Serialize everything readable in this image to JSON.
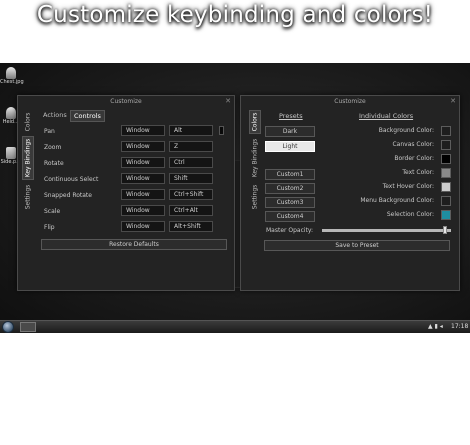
{
  "banner": {
    "title": "Customize keybinding and colors!"
  },
  "desktop": {
    "icons": [
      {
        "label": "Chest.jpg"
      },
      {
        "label": "Heid.."
      },
      {
        "label": "Side.p.."
      }
    ]
  },
  "keybind_dialog": {
    "title": "Customize",
    "close": "✕",
    "side_tabs": [
      "Colors",
      "Key Bindings",
      "Settings"
    ],
    "tabs": [
      "Actions",
      "Controls"
    ],
    "rows": [
      {
        "action": "Pan",
        "scope": "Window",
        "key": "Alt"
      },
      {
        "action": "Zoom",
        "scope": "Window",
        "key": "Z"
      },
      {
        "action": "Rotate",
        "scope": "Window",
        "key": "Ctrl"
      },
      {
        "action": "Continuous Select",
        "scope": "Window",
        "key": "Shift"
      },
      {
        "action": "Snapped Rotate",
        "scope": "Window",
        "key": "Ctrl+Shift"
      },
      {
        "action": "Scale",
        "scope": "Window",
        "key": "Ctrl+Alt"
      },
      {
        "action": "Flip",
        "scope": "Window",
        "key": "Alt+Shift"
      }
    ],
    "restore_label": "Restore Defaults"
  },
  "color_dialog": {
    "title": "Customize",
    "close": "✕",
    "side_tabs": [
      "Colors",
      "Key Bindings",
      "Settings"
    ],
    "presets_heading": "Presets",
    "presets": [
      "Dark",
      "Light"
    ],
    "custom_presets": [
      "Custom1",
      "Custom2",
      "Custom3",
      "Custom4"
    ],
    "individual_heading": "Individual Colors",
    "colors": [
      {
        "label": "Background Color:",
        "color": "#1e1e1e"
      },
      {
        "label": "Canvas Color:",
        "color": "#1e1e1e"
      },
      {
        "label": "Border Color:",
        "color": "#000000"
      },
      {
        "label": "Text Color:",
        "color": "#8a8a8a"
      },
      {
        "label": "Text Hover Color:",
        "color": "#cccccc"
      },
      {
        "label": "Menu Background Color:",
        "color": "#1e1e1e"
      },
      {
        "label": "Selection Color:",
        "color": "#1f8ea0"
      }
    ],
    "opacity_label": "Master Opacity:",
    "opacity_value": 0.97,
    "save_label": "Save to Preset"
  },
  "taskbar": {
    "clock": "17:18"
  }
}
